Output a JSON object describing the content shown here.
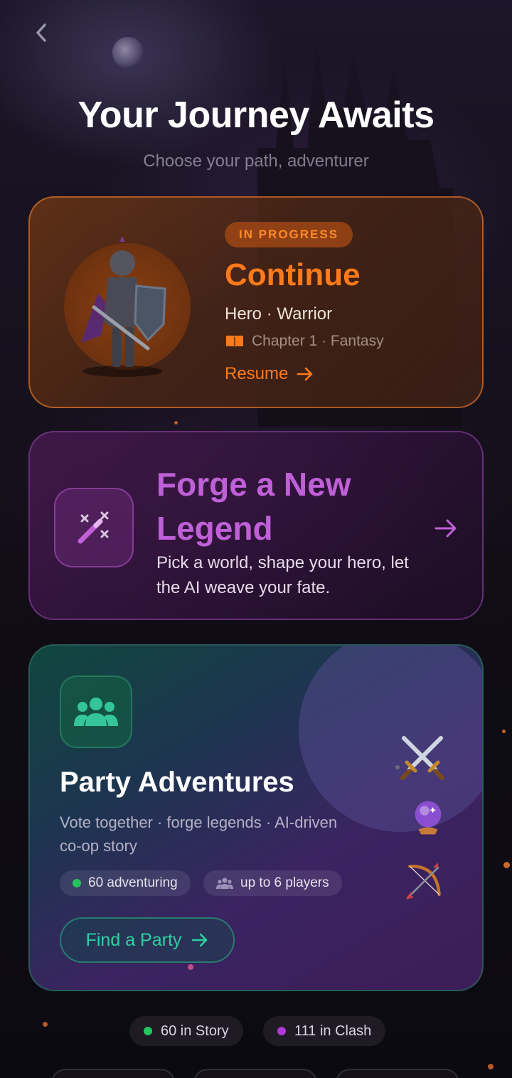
{
  "header": {
    "title": "Your Journey Awaits",
    "subtitle": "Choose your path, adventurer"
  },
  "continue_card": {
    "badge": "IN PROGRESS",
    "title": "Continue",
    "role": "Hero · Warrior",
    "chapter": "Chapter 1 · Fantasy",
    "resume_label": "Resume",
    "accent_color": "#ff7a1a"
  },
  "forge_card": {
    "title": "Forge a New Legend",
    "description": "Pick a world, shape your hero, let the AI weave your fate.",
    "accent_color": "#c060d8",
    "icon": "magic-wand-icon"
  },
  "party_card": {
    "title": "Party Adventures",
    "description": "Vote together · forge legends · AI-driven co-op story",
    "chips": [
      {
        "label": "60 adventuring",
        "icon": "green-dot"
      },
      {
        "label": "up to 6 players",
        "icon": "people-icon"
      }
    ],
    "button_label": "Find a Party",
    "accent_color": "#2fd0a0",
    "decor_icons": [
      "crossed-swords-icon",
      "crystal-ball-icon",
      "bow-and-arrow-icon"
    ]
  },
  "counters": [
    {
      "label": "60 in Story",
      "dot_color": "#22c55e"
    },
    {
      "label": "111 in Clash",
      "dot_color": "#b03ad8"
    }
  ]
}
